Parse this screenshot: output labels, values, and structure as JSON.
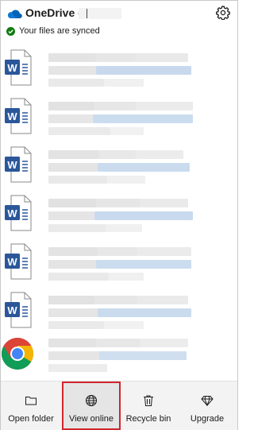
{
  "header": {
    "app_title": "OneDrive -",
    "sync_status": "Your files are synced"
  },
  "colors": {
    "accent": "#0364b8",
    "sync_ok": "#107c10",
    "highlight_border": "#d0262d",
    "word_blue": "#2b579a"
  },
  "file_list": {
    "items": [
      {
        "icon": "word-document-icon"
      },
      {
        "icon": "word-document-icon"
      },
      {
        "icon": "word-document-icon"
      },
      {
        "icon": "word-document-icon"
      },
      {
        "icon": "word-document-icon"
      },
      {
        "icon": "word-document-icon"
      },
      {
        "icon": "chrome-icon"
      }
    ]
  },
  "toolbar": {
    "open_folder_label": "Open folder",
    "view_online_label": "View online",
    "recycle_bin_label": "Recycle bin",
    "upgrade_label": "Upgrade"
  }
}
